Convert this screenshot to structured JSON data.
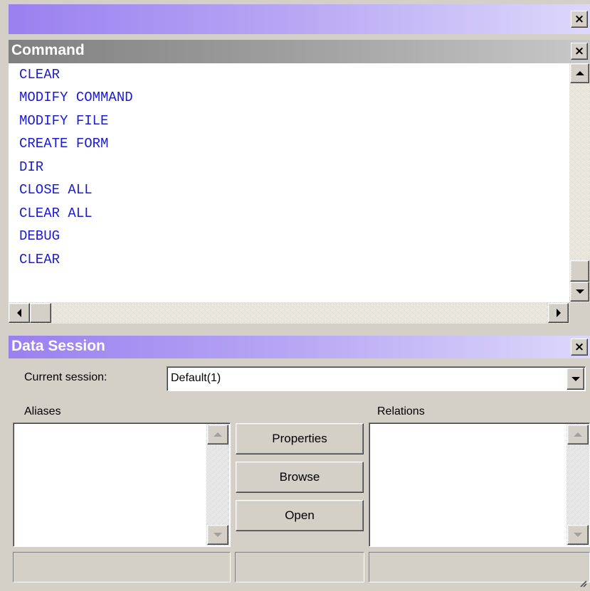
{
  "top_window": {
    "title": "",
    "close_glyph": "×"
  },
  "command_window": {
    "title": "Command",
    "close_glyph": "×",
    "lines": [
      "CLEAR",
      "MODIFY COMMAND",
      "MODIFY FILE",
      "CREATE FORM",
      "DIR",
      "CLOSE ALL",
      "CLEAR ALL",
      "DEBUG",
      "CLEAR"
    ]
  },
  "data_session": {
    "title": "Data Session",
    "close_glyph": "×",
    "current_session_label": "Current session:",
    "current_session_value": "Default(1)",
    "aliases_label": "Aliases",
    "relations_label": "Relations",
    "buttons": {
      "properties": "Properties",
      "browse": "Browse",
      "open": "Open"
    }
  },
  "colors": {
    "active_title_start": "#9a80f0",
    "inactive_title": "#808080",
    "command_text": "#1b1bd6",
    "face": "#d4d0c8"
  }
}
